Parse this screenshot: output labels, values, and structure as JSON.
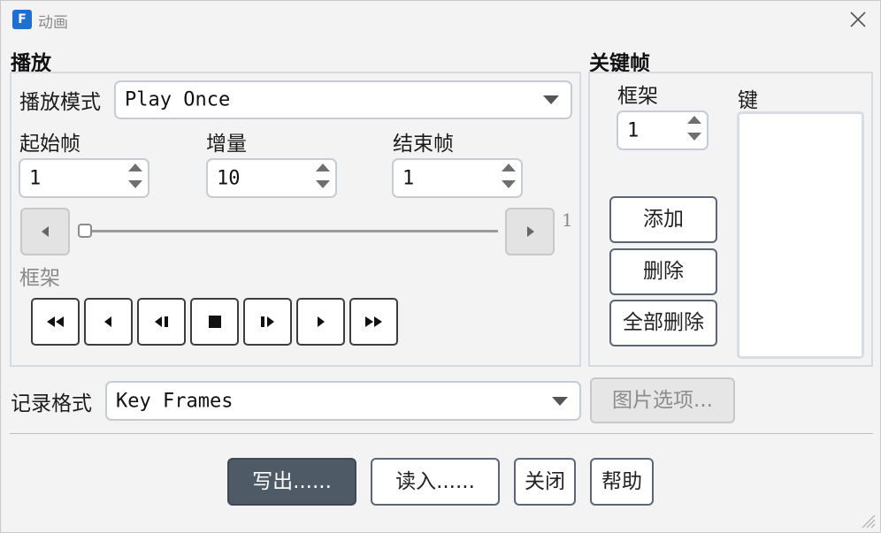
{
  "window": {
    "title": "动画",
    "app_icon_letter": "F"
  },
  "playback": {
    "group_label": "播放",
    "mode_label": "播放模式",
    "mode_value": "Play Once",
    "start_label": "起始帧",
    "start_value": "1",
    "step_label": "增量",
    "step_value": "10",
    "end_label": "结束帧",
    "end_value": "1",
    "slider_value_text": "1",
    "slider_position": 0,
    "frame_label": "框架"
  },
  "keyframes": {
    "group_label": "关键帧",
    "frame_label": "框架",
    "frame_value": "1",
    "key_label": "键",
    "add_button": "添加",
    "delete_button": "删除",
    "delete_all_button": "全部删除",
    "key_items": []
  },
  "record": {
    "label": "记录格式",
    "value": "Key Frames",
    "image_options_button": "图片选项..."
  },
  "footer": {
    "write_button": "写出......",
    "read_button": "读入......",
    "close_button": "关闭",
    "help_button": "帮助"
  }
}
